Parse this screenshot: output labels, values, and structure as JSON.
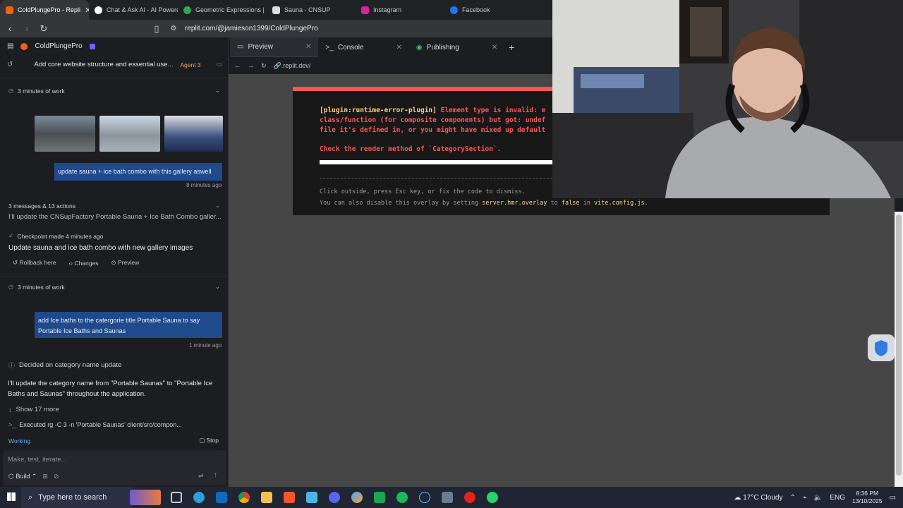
{
  "browser": {
    "tabs": [
      {
        "title": "ColdPlungePro - Repli",
        "color": "#f26207",
        "active": true
      },
      {
        "title": "Chat & Ask AI - AI Powere",
        "color": "#ffffff",
        "active": false
      },
      {
        "title": "Geometric Expressions | B",
        "color": "#2fa84f",
        "active": false
      },
      {
        "title": "Sauna - CNSUP",
        "color": "#dddddd",
        "active": false
      },
      {
        "title": "Instagram",
        "color": "#d6249f",
        "active": false
      },
      {
        "title": "Facebook",
        "color": "#1877f2",
        "active": false
      }
    ],
    "url": "replit.com/@jamieson1399/ColdPlungePro"
  },
  "project": {
    "name": "ColdPlungePro"
  },
  "left": {
    "commit_title": "Add core website structure and essential use...",
    "agent_badge": "Agent 3",
    "work1": "3 minutes of work",
    "msg1": "update sauna + ice bath combo with this gallery aswell",
    "msg1_time": "8 minutes ago",
    "summary": "3 messages & 13 actions",
    "summary_text": "I'll update the CNSupFactory Portable Sauna + Ice Bath Combo galler...",
    "checkpoint": "Checkpoint made 4 minutes ago",
    "checkpoint_desc": "Update sauna and ice bath combo with new gallery images",
    "actions": {
      "rollback": "Rollback here",
      "changes": "Changes",
      "preview": "Preview"
    },
    "work2": "3 minutes of work",
    "msg2": "add Ice baths to the catergorie title Portable Sauna to say Portable Ice Baths and Saunas",
    "msg2_time": "1 minute ago",
    "decided": "Decided on category name update",
    "decided_text": "I'll update the category name from \"Portable Saunas\" to \"Portable Ice Baths and Saunas\" throughout the application.",
    "show_more": "Show 17 more",
    "executed": "Executed rg -C 3 -n 'Portable Saunas' client/src/compon...",
    "working": "Working",
    "stop": "Stop",
    "input_placeholder": "Make, test, iterate...",
    "build": "Build"
  },
  "workspace": {
    "tabs": [
      {
        "label": "Preview"
      },
      {
        "label": "Console"
      },
      {
        "label": "Publishing"
      }
    ],
    "preview_url": ".replit.dev/"
  },
  "error": {
    "line1_plugin": "[plugin:runtime-error-plugin]",
    "line1_rest": " Element type is invalid: e",
    "line2": "class/function (for composite components) but got: undef",
    "line3": "file it's defined in, or you might have mixed up default",
    "line4": "Check the render method of `CategorySection`.",
    "hint1": "Click outside, press Esc key, or fix the code to dismiss.",
    "hint2_a": "You can also disable this overlay by setting ",
    "hint2_key": "server.hmr.overlay",
    "hint2_b": " to ",
    "hint2_val": "false",
    "hint2_c": " in ",
    "hint2_file": "vite.config.js",
    "hint2_d": "."
  },
  "taskbar": {
    "search_placeholder": "Type here to search",
    "weather": "17°C  Cloudy",
    "lang": "ENG",
    "time": "8:36 PM",
    "date": "13/10/2025"
  }
}
